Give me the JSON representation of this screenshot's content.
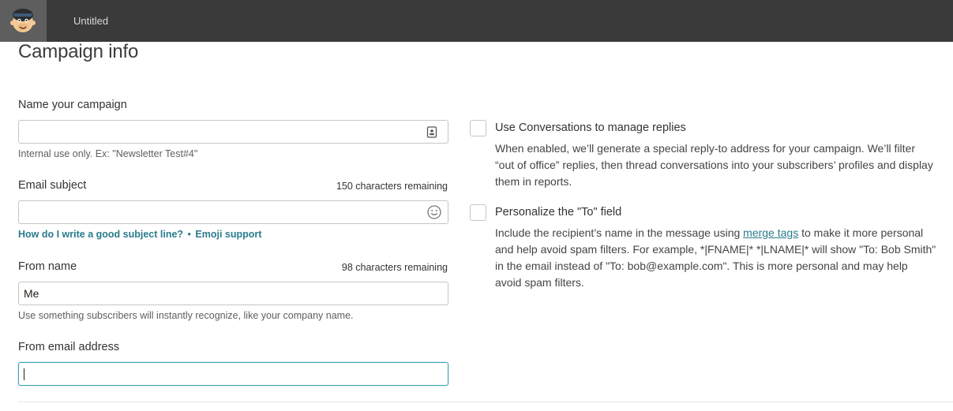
{
  "header": {
    "logo_icon": "mailchimp-freddie-icon",
    "doc_title": "Untitled"
  },
  "page": {
    "title": "Campaign info"
  },
  "fields": {
    "campaign_name": {
      "label": "Name your campaign",
      "value": "",
      "icon": "contact-card-icon",
      "help": "Internal use only. Ex: \"Newsletter Test#4\""
    },
    "email_subject": {
      "label": "Email subject",
      "counter": "150 characters remaining",
      "value": "",
      "icon": "emoji-smiley-icon",
      "link_subject_help": "How do I write a good subject line?",
      "link_separator": "•",
      "link_emoji": "Emoji support"
    },
    "from_name": {
      "label": "From name",
      "counter": "98 characters remaining",
      "value": "Me",
      "help": "Use something subscribers will instantly recognize, like your company name."
    },
    "from_email": {
      "label": "From email address",
      "value": ""
    }
  },
  "options": {
    "conversations": {
      "title": "Use Conversations to manage replies",
      "description": "When enabled, we’ll generate a special reply-to address for your campaign. We’ll filter “out of office” replies, then thread conversations into your subscribers’ profiles and display them in reports.",
      "checked": false
    },
    "personalize_to": {
      "title": "Personalize the \"To\" field",
      "desc_before": "Include the recipient’s name in the message using ",
      "desc_link": "merge tags",
      "desc_after": " to make it more personal and help avoid spam filters. For example, *|FNAME|* *|LNAME|* will show \"To: Bob Smith\" in the email instead of \"To: bob@example.com\". This is more personal and may help avoid spam filters.",
      "checked": false
    }
  },
  "colors": {
    "topbar": "#3a3a3a",
    "link": "#2a7b8c",
    "focus_border": "#3aa3b7"
  }
}
